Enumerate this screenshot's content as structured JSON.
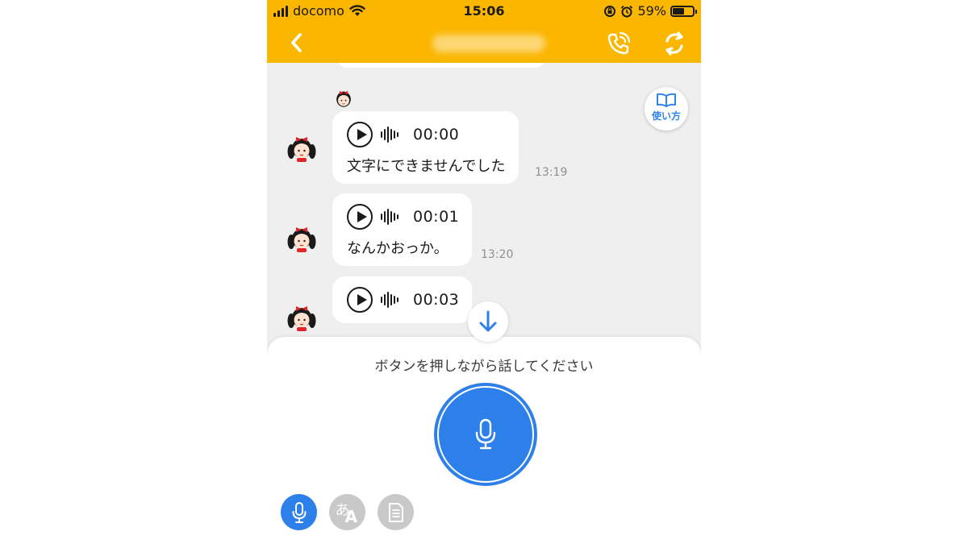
{
  "status_bar": {
    "carrier": "docomo",
    "time": "15:06",
    "battery_percent": "59%",
    "battery_level": 0.59
  },
  "nav": {
    "back_icon": "chevron-left-icon",
    "call_icon": "phone-call-icon",
    "refresh_icon": "refresh-icon"
  },
  "howto": {
    "label": "使い方"
  },
  "messages": [
    {
      "duration": "00:00",
      "text": "文字にできませんでした",
      "time": "13:19"
    },
    {
      "duration": "00:01",
      "text": "なんかおっか。",
      "time": "13:20"
    },
    {
      "duration": "00:03",
      "text": "",
      "time": ""
    }
  ],
  "panel": {
    "instruction": "ボタンを押しながら話してください",
    "modes": [
      {
        "name": "voice",
        "icon": "microphone-icon",
        "active": true
      },
      {
        "name": "translate",
        "icon": "translate-icon",
        "glyph_a": "あ",
        "glyph_b": "A",
        "active": false
      },
      {
        "name": "text",
        "icon": "document-icon",
        "active": false
      }
    ]
  },
  "colors": {
    "header": "#fbb600",
    "accent_blue": "#2d80ea",
    "chat_bg": "#efefef",
    "inactive_mode": "#c9c9c9"
  }
}
